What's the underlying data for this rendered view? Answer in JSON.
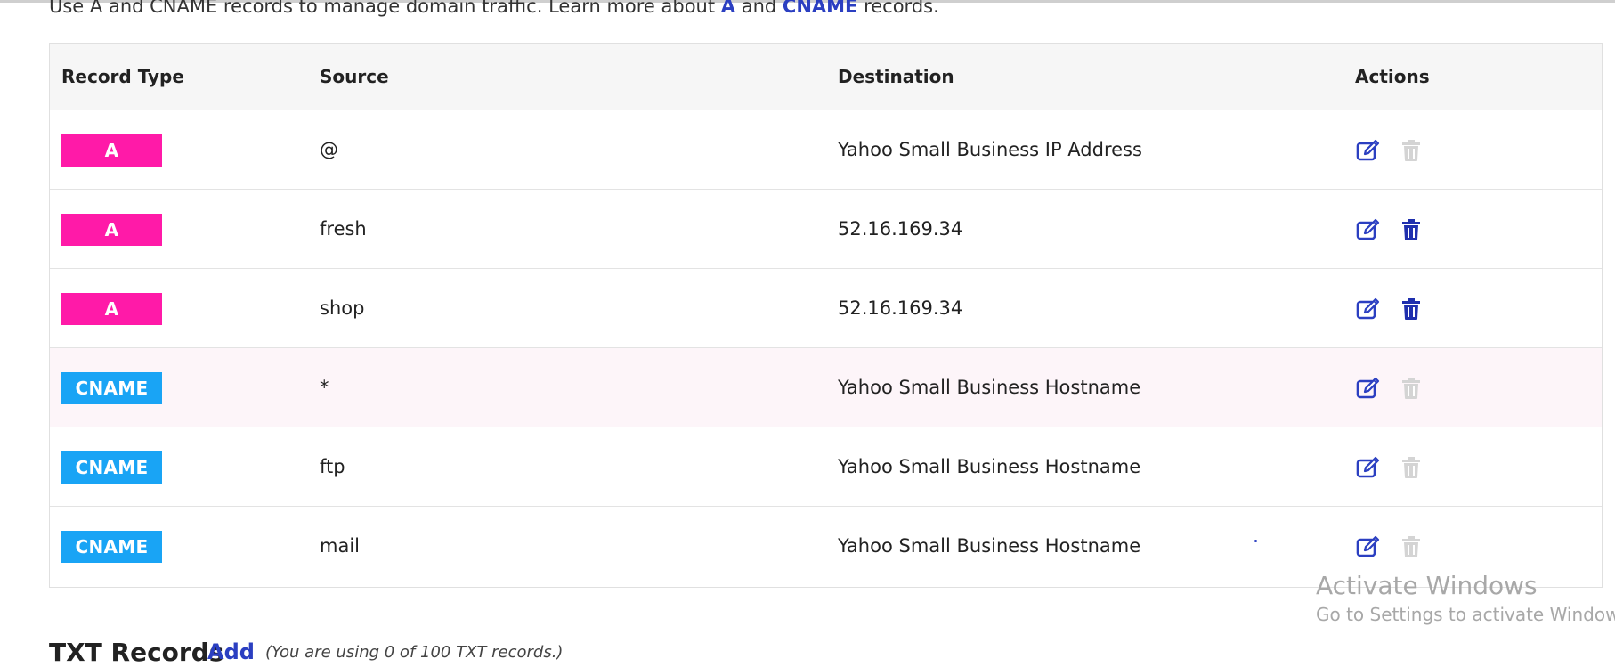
{
  "intro": {
    "prefix": "Use A and CNAME records to manage domain traffic. Learn more about ",
    "link_a": "A",
    "middle": " and ",
    "link_cname": "CNAME",
    "suffix": " records."
  },
  "table": {
    "headers": {
      "type": "Record Type",
      "source": "Source",
      "destination": "Destination",
      "actions": "Actions"
    },
    "rows": [
      {
        "type": "A",
        "source": "@",
        "destination": "Yahoo Small Business IP Address",
        "delete_enabled": false
      },
      {
        "type": "A",
        "source": "fresh",
        "destination": "52.16.169.34",
        "delete_enabled": true
      },
      {
        "type": "A",
        "source": "shop",
        "destination": "52.16.169.34",
        "delete_enabled": true
      },
      {
        "type": "CNAME",
        "source": "*",
        "destination": "Yahoo Small Business Hostname",
        "delete_enabled": false
      },
      {
        "type": "CNAME",
        "source": "ftp",
        "destination": "Yahoo Small Business Hostname",
        "delete_enabled": false
      },
      {
        "type": "CNAME",
        "source": "mail",
        "destination": "Yahoo Small Business Hostname",
        "delete_enabled": false
      }
    ]
  },
  "icons": {
    "edit": "edit-icon",
    "delete": "trash-icon"
  },
  "colors": {
    "a_badge": "#ff1aa8",
    "cname_badge": "#19a4f5",
    "link": "#2b3fc1",
    "edit_icon": "#2b3fc1",
    "delete_active": "#1f2fae",
    "delete_disabled": "#d4d4d4"
  },
  "txt_section": {
    "title": "TXT Records",
    "add_label": "Add",
    "note": "(You are using 0 of 100 TXT records.)"
  },
  "watermark": {
    "line1": "Activate Windows",
    "line2": "Go to Settings to activate Windows."
  }
}
